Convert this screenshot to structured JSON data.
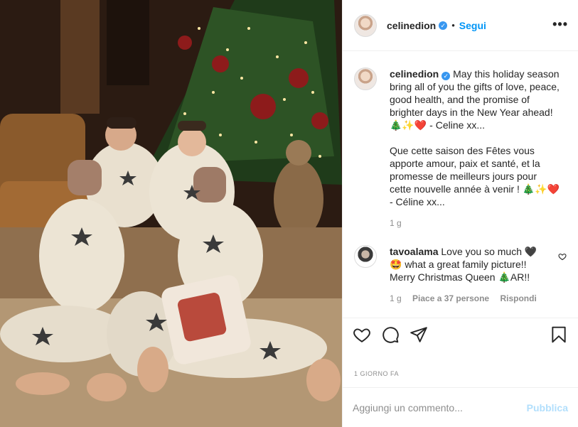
{
  "header": {
    "username": "celinedion",
    "separator": "•",
    "follow_label": "Segui",
    "more_label": "•••"
  },
  "caption": {
    "username": "celinedion",
    "text_en": "May this holiday season bring all of you the gifts of love, peace, good health, and the  promise of brighter days in the New Year ahead! 🎄✨❤️ - Celine xx...",
    "text_fr": "Que cette saison des Fêtes vous apporte amour, paix et santé, et la promesse de meilleurs jours pour cette nouvelle année à venir ! 🎄✨❤️ - Céline xx...",
    "time": "1 g"
  },
  "comment": {
    "username": "tavoalama",
    "text": "Love you so much 🖤 🤩 what a great family picture!! Merry Christmas Queen 🎄AR!!",
    "time": "1 g",
    "likes": "Piace a 37 persone",
    "reply": "Rispondi"
  },
  "post_age": "1 GIORNO FA",
  "add_comment": {
    "placeholder": "Aggiungi un commento...",
    "publish_label": "Pubblica"
  },
  "icons": {
    "like": "heart-icon",
    "comment": "comment-icon",
    "share": "share-icon",
    "save": "bookmark-icon",
    "comment_like": "heart-small-icon",
    "verified": "verified-badge-icon",
    "more": "more-options-icon"
  },
  "colors": {
    "link_blue": "#0095f6",
    "verified_blue": "#3897f0",
    "muted_text": "#8e8e8e",
    "publish_disabled": "#b2dffc"
  }
}
